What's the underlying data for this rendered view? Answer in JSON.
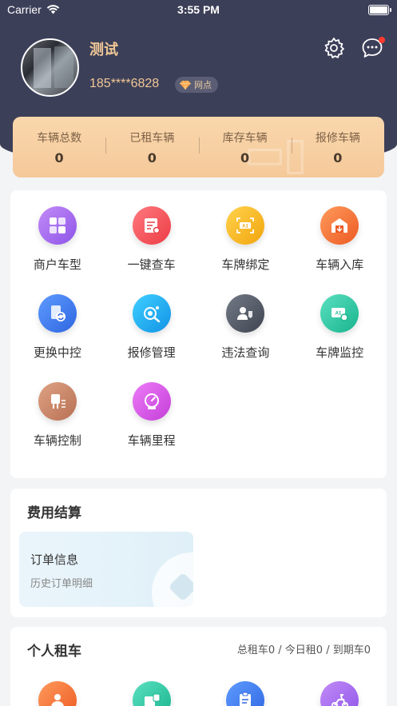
{
  "status_bar": {
    "carrier": "Carrier",
    "time": "3:55 PM"
  },
  "profile": {
    "name": "测试",
    "phone": "185****6828",
    "badge": "网点"
  },
  "stats": [
    {
      "label": "车辆总数",
      "value": "0"
    },
    {
      "label": "已租车辆",
      "value": "0"
    },
    {
      "label": "库存车辆",
      "value": "0"
    },
    {
      "label": "报修车辆",
      "value": "0"
    }
  ],
  "menu": [
    {
      "label": "商户车型",
      "icon": "merchant-model-icon",
      "color": "#a86ef0"
    },
    {
      "label": "一键查车",
      "icon": "vehicle-check-icon",
      "color": "#f2545b"
    },
    {
      "label": "车牌绑定",
      "icon": "plate-bind-icon",
      "color": "#f6b51c"
    },
    {
      "label": "车辆入库",
      "icon": "vehicle-storage-icon",
      "color": "#f36b2e"
    },
    {
      "label": "更换中控",
      "icon": "replace-controller-icon",
      "color": "#3f7df0"
    },
    {
      "label": "报修管理",
      "icon": "repair-manage-icon",
      "color": "#20a9f0"
    },
    {
      "label": "违法查询",
      "icon": "violation-query-icon",
      "color": "#555b67"
    },
    {
      "label": "车牌监控",
      "icon": "plate-monitor-icon",
      "color": "#2ecba6"
    },
    {
      "label": "车辆控制",
      "icon": "vehicle-control-icon",
      "color": "#c9886b"
    },
    {
      "label": "车辆里程",
      "icon": "vehicle-mileage-icon",
      "color": "#d45be6"
    }
  ],
  "fees": {
    "title": "费用结算",
    "order_title": "订单信息",
    "order_subtitle": "历史订单明细"
  },
  "rent": {
    "title": "个人租车",
    "summary": "总租车0 / 今日租0 / 到期车0",
    "icons": [
      {
        "icon": "renter-icon",
        "color": "#f36b2e"
      },
      {
        "icon": "contract-icon",
        "color": "#2ecba6"
      },
      {
        "icon": "clipboard-icon",
        "color": "#3f7df0"
      },
      {
        "icon": "scooter-icon",
        "color": "#a86ef0"
      }
    ]
  }
}
